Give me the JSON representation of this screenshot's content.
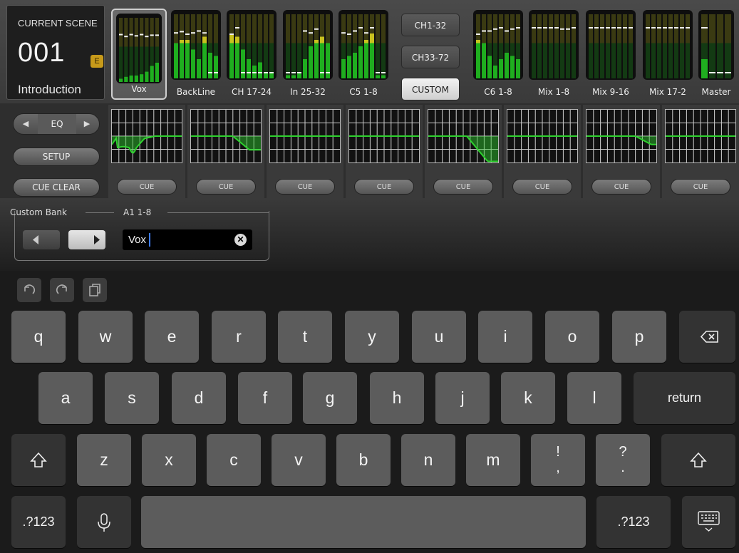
{
  "scene": {
    "title": "CURRENT SCENE",
    "number": "001",
    "badge": "E",
    "name": "Introduction"
  },
  "meter_groups": [
    {
      "label": "Vox",
      "selected": true,
      "levels": [
        0.05,
        0.08,
        0.1,
        0.1,
        0.12,
        0.16,
        0.25,
        0.3
      ],
      "peaks": [
        0.75,
        0.72,
        0.75,
        0.73,
        0.75,
        0.72,
        0.74,
        0.74
      ]
    },
    {
      "label": "BackLine",
      "selected": false,
      "levels": [
        0.55,
        0.6,
        0.6,
        0.45,
        0.3,
        0.65,
        0.4,
        0.35
      ],
      "peaks": [
        0.72,
        0.74,
        0.7,
        0.72,
        0.75,
        0.72,
        0.1,
        0.1
      ]
    },
    {
      "label": "CH 17-24",
      "selected": false,
      "levels": [
        0.7,
        0.65,
        0.45,
        0.3,
        0.2,
        0.25,
        0.1,
        0.08
      ],
      "peaks": [
        0.7,
        0.8,
        0.1,
        0.1,
        0.1,
        0.1,
        0.1,
        0.1
      ]
    },
    {
      "label": "In 25-32",
      "selected": false,
      "levels": [
        0.05,
        0.05,
        0.1,
        0.3,
        0.5,
        0.6,
        0.65,
        0.55
      ],
      "peaks": [
        0.1,
        0.1,
        0.1,
        0.75,
        0.72,
        0.78,
        0.1,
        0.1
      ]
    },
    {
      "label": "C5 1-8",
      "selected": false,
      "levels": [
        0.3,
        0.35,
        0.4,
        0.5,
        0.6,
        0.7,
        0.05,
        0.05
      ],
      "peaks": [
        0.72,
        0.7,
        0.75,
        0.8,
        0.72,
        0.8,
        0.1,
        0.1
      ]
    },
    {
      "label": "C6 1-8",
      "selected": false,
      "levels": [
        0.6,
        0.55,
        0.35,
        0.2,
        0.3,
        0.4,
        0.35,
        0.3
      ],
      "peaks": [
        0.7,
        0.75,
        0.75,
        0.78,
        0.8,
        0.75,
        0.78,
        0.8
      ]
    },
    {
      "label": "Mix 1-8",
      "selected": false,
      "levels": [
        0,
        0,
        0,
        0,
        0,
        0,
        0,
        0
      ],
      "peaks": [
        0.8,
        0.8,
        0.8,
        0.8,
        0.8,
        0.78,
        0.78,
        0.8
      ]
    },
    {
      "label": "Mix 9-16",
      "selected": false,
      "levels": [
        0,
        0,
        0,
        0,
        0,
        0,
        0,
        0
      ],
      "peaks": [
        0.8,
        0.8,
        0.8,
        0.8,
        0.8,
        0.8,
        0.8,
        0.8
      ]
    },
    {
      "label": "Mix 17-2",
      "selected": false,
      "levels": [
        0,
        0,
        0,
        0,
        0,
        0,
        0,
        0
      ],
      "peaks": [
        0.8,
        0.8,
        0.8,
        0.8,
        0.8,
        0.8,
        0.8,
        0.8
      ]
    },
    {
      "label": "Master",
      "selected": false,
      "levels": [
        0.3,
        0,
        0,
        0
      ],
      "peaks": [
        0.8,
        0.1,
        0.1,
        0.1
      ]
    }
  ],
  "bank_buttons": [
    {
      "label": "CH1-32",
      "active": false
    },
    {
      "label": "CH33-72",
      "active": false
    },
    {
      "label": "CUSTOM",
      "active": true
    }
  ],
  "eq": {
    "nav_label": "EQ",
    "prev_icon": "triangle-left-icon",
    "next_icon": "triangle-right-icon",
    "setup_label": "SETUP",
    "cue_clear_label": "CUE CLEAR",
    "cue_label": "CUE",
    "strips": [
      {
        "curve": "scoop"
      },
      {
        "curve": "hishelf-small"
      },
      {
        "curve": "flat"
      },
      {
        "curve": "flat"
      },
      {
        "curve": "hishelf-big"
      },
      {
        "curve": "flat"
      },
      {
        "curve": "hishelf-mid"
      },
      {
        "curve": "flat"
      }
    ]
  },
  "custom_bank": {
    "label": "Custom Bank",
    "bank": "A1 1-8",
    "name_value": "Vox",
    "clear_icon": "clear-x-icon"
  },
  "keyboard": {
    "tools": [
      "undo-icon",
      "redo-icon",
      "paste-icon"
    ],
    "row1": [
      "q",
      "w",
      "e",
      "r",
      "t",
      "y",
      "u",
      "i",
      "o",
      "p"
    ],
    "row2": [
      "a",
      "s",
      "d",
      "f",
      "g",
      "h",
      "j",
      "k",
      "l"
    ],
    "row3": [
      "z",
      "x",
      "c",
      "v",
      "b",
      "n",
      "m"
    ],
    "punct1": {
      "top": "!",
      "bottom": ","
    },
    "punct2": {
      "top": "?",
      "bottom": "."
    },
    "return_label": "return",
    "numbers_label": ".?123",
    "backspace_icon": "backspace-icon",
    "shift_icon": "shift-icon",
    "mic_icon": "microphone-icon",
    "hide_icon": "keyboard-hide-icon"
  },
  "colors": {
    "meter_green": "#1fae1f",
    "meter_yellow": "#c8c21e",
    "eq_curve": "#2ed12e",
    "accent_caret": "#3f7dff"
  }
}
